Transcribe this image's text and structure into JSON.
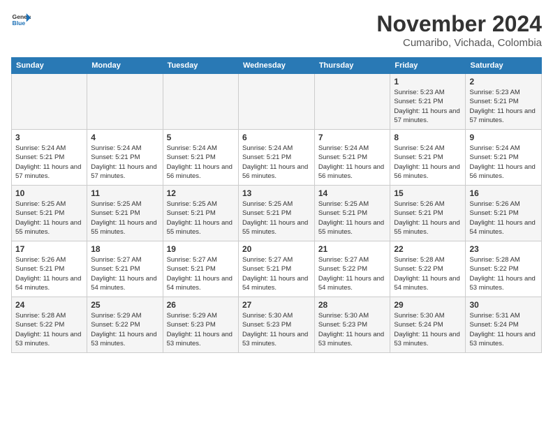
{
  "header": {
    "logo_line1": "General",
    "logo_line2": "Blue",
    "month": "November 2024",
    "location": "Cumaribo, Vichada, Colombia"
  },
  "weekdays": [
    "Sunday",
    "Monday",
    "Tuesday",
    "Wednesday",
    "Thursday",
    "Friday",
    "Saturday"
  ],
  "weeks": [
    [
      {
        "day": "",
        "info": ""
      },
      {
        "day": "",
        "info": ""
      },
      {
        "day": "",
        "info": ""
      },
      {
        "day": "",
        "info": ""
      },
      {
        "day": "",
        "info": ""
      },
      {
        "day": "1",
        "info": "Sunrise: 5:23 AM\nSunset: 5:21 PM\nDaylight: 11 hours and 57 minutes."
      },
      {
        "day": "2",
        "info": "Sunrise: 5:23 AM\nSunset: 5:21 PM\nDaylight: 11 hours and 57 minutes."
      }
    ],
    [
      {
        "day": "3",
        "info": "Sunrise: 5:24 AM\nSunset: 5:21 PM\nDaylight: 11 hours and 57 minutes."
      },
      {
        "day": "4",
        "info": "Sunrise: 5:24 AM\nSunset: 5:21 PM\nDaylight: 11 hours and 57 minutes."
      },
      {
        "day": "5",
        "info": "Sunrise: 5:24 AM\nSunset: 5:21 PM\nDaylight: 11 hours and 56 minutes."
      },
      {
        "day": "6",
        "info": "Sunrise: 5:24 AM\nSunset: 5:21 PM\nDaylight: 11 hours and 56 minutes."
      },
      {
        "day": "7",
        "info": "Sunrise: 5:24 AM\nSunset: 5:21 PM\nDaylight: 11 hours and 56 minutes."
      },
      {
        "day": "8",
        "info": "Sunrise: 5:24 AM\nSunset: 5:21 PM\nDaylight: 11 hours and 56 minutes."
      },
      {
        "day": "9",
        "info": "Sunrise: 5:24 AM\nSunset: 5:21 PM\nDaylight: 11 hours and 56 minutes."
      }
    ],
    [
      {
        "day": "10",
        "info": "Sunrise: 5:25 AM\nSunset: 5:21 PM\nDaylight: 11 hours and 55 minutes."
      },
      {
        "day": "11",
        "info": "Sunrise: 5:25 AM\nSunset: 5:21 PM\nDaylight: 11 hours and 55 minutes."
      },
      {
        "day": "12",
        "info": "Sunrise: 5:25 AM\nSunset: 5:21 PM\nDaylight: 11 hours and 55 minutes."
      },
      {
        "day": "13",
        "info": "Sunrise: 5:25 AM\nSunset: 5:21 PM\nDaylight: 11 hours and 55 minutes."
      },
      {
        "day": "14",
        "info": "Sunrise: 5:25 AM\nSunset: 5:21 PM\nDaylight: 11 hours and 55 minutes."
      },
      {
        "day": "15",
        "info": "Sunrise: 5:26 AM\nSunset: 5:21 PM\nDaylight: 11 hours and 55 minutes."
      },
      {
        "day": "16",
        "info": "Sunrise: 5:26 AM\nSunset: 5:21 PM\nDaylight: 11 hours and 54 minutes."
      }
    ],
    [
      {
        "day": "17",
        "info": "Sunrise: 5:26 AM\nSunset: 5:21 PM\nDaylight: 11 hours and 54 minutes."
      },
      {
        "day": "18",
        "info": "Sunrise: 5:27 AM\nSunset: 5:21 PM\nDaylight: 11 hours and 54 minutes."
      },
      {
        "day": "19",
        "info": "Sunrise: 5:27 AM\nSunset: 5:21 PM\nDaylight: 11 hours and 54 minutes."
      },
      {
        "day": "20",
        "info": "Sunrise: 5:27 AM\nSunset: 5:21 PM\nDaylight: 11 hours and 54 minutes."
      },
      {
        "day": "21",
        "info": "Sunrise: 5:27 AM\nSunset: 5:22 PM\nDaylight: 11 hours and 54 minutes."
      },
      {
        "day": "22",
        "info": "Sunrise: 5:28 AM\nSunset: 5:22 PM\nDaylight: 11 hours and 54 minutes."
      },
      {
        "day": "23",
        "info": "Sunrise: 5:28 AM\nSunset: 5:22 PM\nDaylight: 11 hours and 53 minutes."
      }
    ],
    [
      {
        "day": "24",
        "info": "Sunrise: 5:28 AM\nSunset: 5:22 PM\nDaylight: 11 hours and 53 minutes."
      },
      {
        "day": "25",
        "info": "Sunrise: 5:29 AM\nSunset: 5:22 PM\nDaylight: 11 hours and 53 minutes."
      },
      {
        "day": "26",
        "info": "Sunrise: 5:29 AM\nSunset: 5:23 PM\nDaylight: 11 hours and 53 minutes."
      },
      {
        "day": "27",
        "info": "Sunrise: 5:30 AM\nSunset: 5:23 PM\nDaylight: 11 hours and 53 minutes."
      },
      {
        "day": "28",
        "info": "Sunrise: 5:30 AM\nSunset: 5:23 PM\nDaylight: 11 hours and 53 minutes."
      },
      {
        "day": "29",
        "info": "Sunrise: 5:30 AM\nSunset: 5:24 PM\nDaylight: 11 hours and 53 minutes."
      },
      {
        "day": "30",
        "info": "Sunrise: 5:31 AM\nSunset: 5:24 PM\nDaylight: 11 hours and 53 minutes."
      }
    ]
  ]
}
